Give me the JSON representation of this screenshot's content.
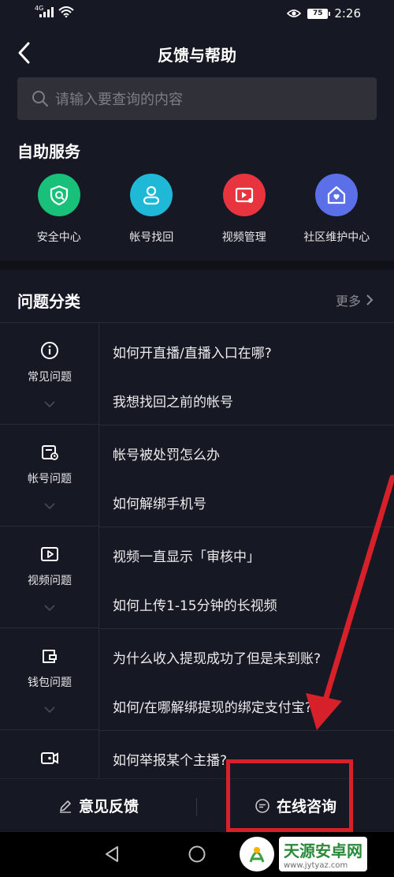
{
  "status_bar": {
    "network": "4G",
    "time": "2:26",
    "battery": "75"
  },
  "header": {
    "title": "反馈与帮助"
  },
  "search": {
    "placeholder": "请输入要查询的内容"
  },
  "self_service": {
    "title": "自助服务",
    "items": [
      {
        "label": "安全中心",
        "icon": "shield-icon",
        "color": "#19c07a"
      },
      {
        "label": "帐号找回",
        "icon": "user-icon",
        "color": "#1fb8d6"
      },
      {
        "label": "视频管理",
        "icon": "video-manage-icon",
        "color": "#e8343f"
      },
      {
        "label": "社区维护中心",
        "icon": "home-heart-icon",
        "color": "#5b70e8"
      }
    ]
  },
  "categories": {
    "title": "问题分类",
    "more_label": "更多",
    "items": [
      {
        "label": "常见问题",
        "icon": "info-icon",
        "questions": [
          "如何开直播/直播入口在哪?",
          "我想找回之前的帐号"
        ]
      },
      {
        "label": "帐号问题",
        "icon": "account-card-icon",
        "questions": [
          "帐号被处罚怎么办",
          "如何解绑手机号"
        ]
      },
      {
        "label": "视频问题",
        "icon": "play-icon",
        "questions": [
          "视频一直显示「审核中」",
          "如何上传1-15分钟的长视频"
        ]
      },
      {
        "label": "钱包问题",
        "icon": "wallet-icon",
        "questions": [
          "为什么收入提现成功了但是未到账?",
          "如何/在哪解绑提现的绑定支付宝?"
        ]
      },
      {
        "label": "",
        "icon": "live-camera-icon",
        "questions": [
          "如何举报某个主播?"
        ]
      }
    ]
  },
  "bottom_bar": {
    "feedback_label": "意见反馈",
    "consult_label": "在线咨询"
  },
  "watermark": {
    "title": "天源安卓网",
    "url": "www.jytyaz.com"
  },
  "colors": {
    "background": "#161823",
    "annotation": "#d6202a"
  }
}
